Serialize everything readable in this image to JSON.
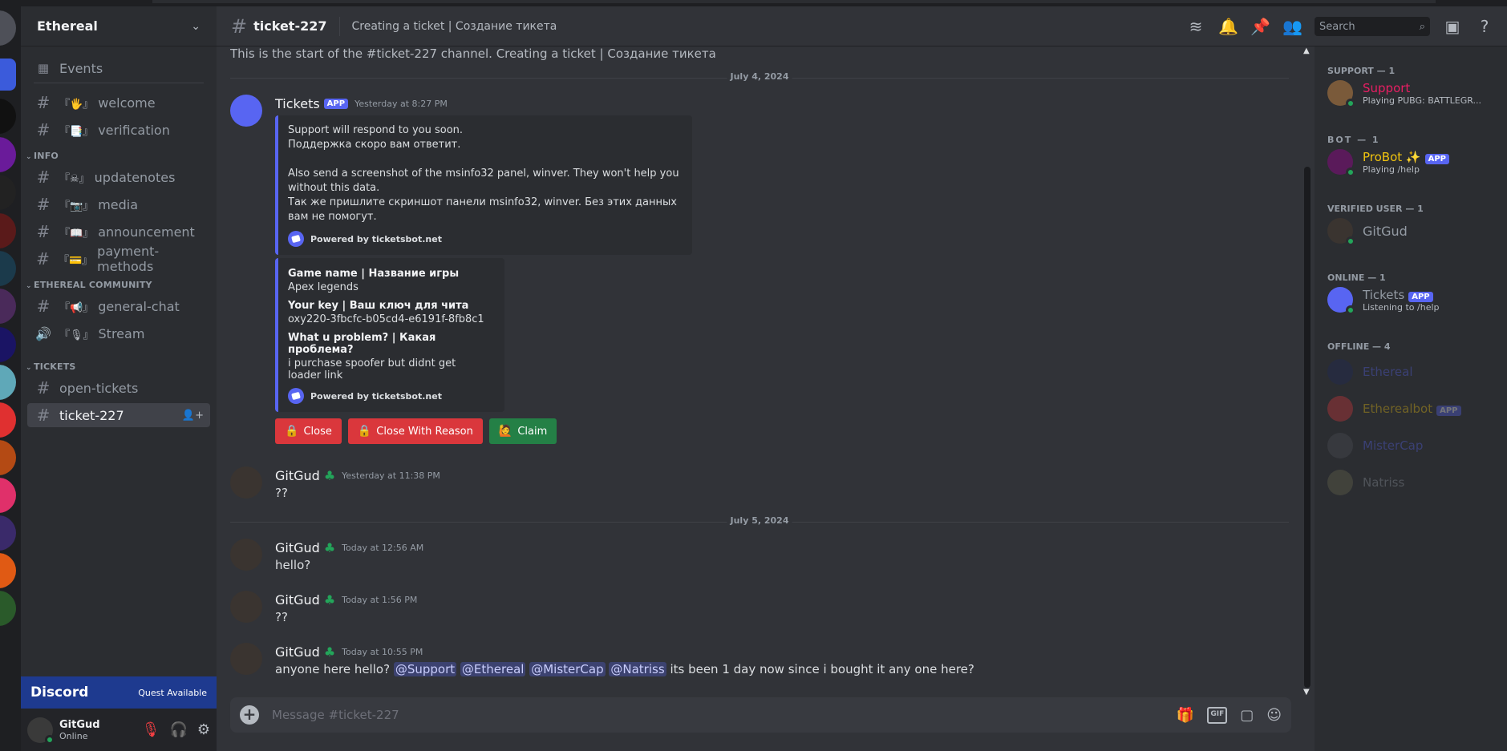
{
  "guild": {
    "name": "Ethereal"
  },
  "sidebar": {
    "events_label": "Events",
    "channels_top": [
      {
        "name": "welcome",
        "emoji": "『🖐』"
      },
      {
        "name": "verification",
        "emoji": "『📑』"
      }
    ],
    "categories": [
      {
        "name": "INFO",
        "channels": [
          {
            "name": "updatenotes",
            "emoji": "『☠』"
          },
          {
            "name": "media",
            "emoji": "『📷』"
          },
          {
            "name": "announcement",
            "emoji": "『📖』"
          },
          {
            "name": "payment-methods",
            "emoji": "『💳』"
          }
        ]
      },
      {
        "name": "ETHEREAL COMMUNITY",
        "channels": [
          {
            "name": "general-chat",
            "emoji": "『📢』"
          },
          {
            "name": "Stream",
            "emoji": "『🎙』"
          }
        ]
      },
      {
        "name": "TICKETS",
        "channels": [
          {
            "name": "open-tickets",
            "emoji": ""
          },
          {
            "name": "ticket-227",
            "emoji": ""
          }
        ]
      }
    ]
  },
  "quest": {
    "logo": "Discord",
    "label": "Quest Available"
  },
  "user": {
    "name": "GitGud",
    "status": "Online"
  },
  "header": {
    "channel": "ticket-227",
    "topic": "Creating a ticket | Создание тикета",
    "search_placeholder": "Search"
  },
  "chat": {
    "start_text": "This is the start of the #ticket-227 channel. Creating a ticket | Создание тикета",
    "date1": "July 4, 2024",
    "date2": "July 5, 2024",
    "bot_message": {
      "author": "Tickets",
      "badge": "APP",
      "time": "Yesterday at 8:27 PM",
      "embed1_lines": [
        "Support will respond to you soon.",
        "Поддержка скоро вам ответит.",
        "Also send a screenshot of the msinfo32 panel, winver. They won't help you without this data.",
        "Так же пришлите скриншот панели msinfo32, winver. Без этих данных вам не помогут."
      ],
      "footer": "Powered by ticketsbot.net",
      "embed2_fields": [
        {
          "name": "Game name | Название игры",
          "value": "Apex legends"
        },
        {
          "name": "Your key | Ваш ключ для чита",
          "value": "oxy220-3fbcfc-b05cd4-e6191f-8fb8c1"
        },
        {
          "name": "What u problem? | Какая проблема?",
          "value": "i purchase spoofer but didnt get loader link"
        }
      ],
      "buttons": {
        "close": "Close",
        "close_reason": "Close With Reason",
        "claim": "Claim"
      }
    },
    "messages": [
      {
        "author": "GitGud",
        "time": "Yesterday at 11:38 PM",
        "text": "??"
      },
      {
        "author": "GitGud",
        "time": "Today at 12:56 AM",
        "text": "hello?"
      },
      {
        "author": "GitGud",
        "time": "Today at 1:56 PM",
        "text": "??"
      },
      {
        "author": "GitGud",
        "time": "Today at 10:55 PM",
        "text_start": "anyone here hello?",
        "mentions": [
          "@Support",
          "@Ethereal",
          "@MisterCap",
          "@Natriss"
        ],
        "text_end": "its been 1 day now since i bought it any one here?"
      }
    ]
  },
  "composer": {
    "placeholder": "Message #ticket-227",
    "gif_label": "GIF"
  },
  "members": {
    "groups": [
      {
        "title": "SUPPORT — 1",
        "members": [
          {
            "name": "Support",
            "activity": "Playing PUBG: BATTLEGR...",
            "color": "#e91e63"
          }
        ]
      },
      {
        "title": "ΒΟΤ — 1",
        "members": [
          {
            "name": "ProBot ✨",
            "badge": "APP",
            "activity": "Playing /help",
            "color": "#f1c40f"
          }
        ]
      },
      {
        "title": "VERIFIED USER — 1",
        "members": [
          {
            "name": "GitGud",
            "activity": "",
            "color": "#949ba4"
          }
        ]
      },
      {
        "title": "ONLINE — 1",
        "members": [
          {
            "name": "Tickets",
            "badge": "APP",
            "activity": "Listening to /help",
            "color": "#949ba4"
          }
        ]
      },
      {
        "title": "OFFLINE — 4",
        "members": [
          {
            "name": "Ethereal",
            "color": "#5865f2"
          },
          {
            "name": "Etherealbot",
            "badge": "APP",
            "color": "#f1c40f"
          },
          {
            "name": "MisterCap",
            "color": "#5865f2"
          },
          {
            "name": "Natriss",
            "color": "#949ba4"
          }
        ]
      }
    ]
  },
  "colors": {
    "accent": "#5865f2",
    "danger": "#da373c",
    "success": "#248046",
    "online": "#23a55a"
  }
}
